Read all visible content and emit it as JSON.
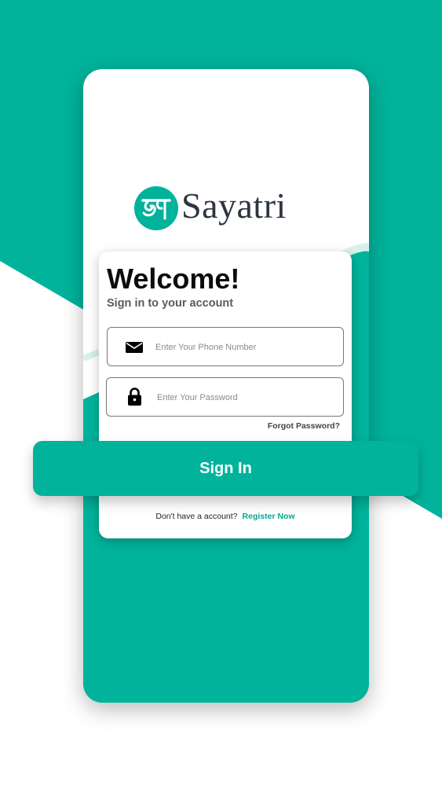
{
  "colors": {
    "accent": "#01b39b",
    "text_dark": "#0c0c0c",
    "link": "#01a892"
  },
  "brand": {
    "name": "Sayatri",
    "logo_glyph": "स",
    "logo_icon": "sayatri-logo-icon"
  },
  "login": {
    "title": "Welcome!",
    "subtitle": "Sign in to your account",
    "phone_field": {
      "placeholder": "Enter Your Phone Number",
      "value": "",
      "icon": "envelope-icon"
    },
    "password_field": {
      "placeholder": "Enter Your Password",
      "value": "",
      "icon": "lock-icon"
    },
    "forgot_label": "Forgot Password?",
    "signin_label": "Sign In",
    "register_prompt": "Don't have a account?",
    "register_label": "Register Now"
  }
}
